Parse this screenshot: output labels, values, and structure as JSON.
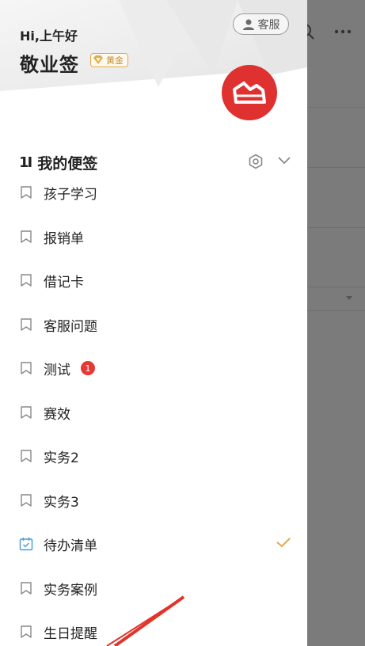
{
  "header": {
    "greeting": "Hi,上午好",
    "app_name": "敬业签",
    "vip_label": "黄金",
    "customer_service_label": "客服"
  },
  "section": {
    "icon_text": "1Ⅰ",
    "title": "我的便签"
  },
  "items": [
    {
      "label": "孩子学习",
      "icon": "bookmark-icon"
    },
    {
      "label": "报销单",
      "icon": "bookmark-icon"
    },
    {
      "label": "借记卡",
      "icon": "bookmark-icon"
    },
    {
      "label": "客服问题",
      "icon": "bookmark-icon"
    },
    {
      "label": "测试",
      "icon": "bookmark-icon",
      "badge": "1"
    },
    {
      "label": "赛效",
      "icon": "bookmark-icon"
    },
    {
      "label": "实务2",
      "icon": "bookmark-icon"
    },
    {
      "label": "实务3",
      "icon": "bookmark-icon"
    },
    {
      "label": "待办清单",
      "icon": "calendar-check-icon",
      "selected": true
    },
    {
      "label": "实务案例",
      "icon": "bookmark-icon"
    },
    {
      "label": "生日提醒",
      "icon": "bookmark-icon"
    }
  ],
  "colors": {
    "brand_red": "#e03131",
    "gold": "#e2a84a",
    "badge_red": "#e53935",
    "todo_blue": "#4a9fd8",
    "overlay_gray": "#7b7b7b"
  }
}
